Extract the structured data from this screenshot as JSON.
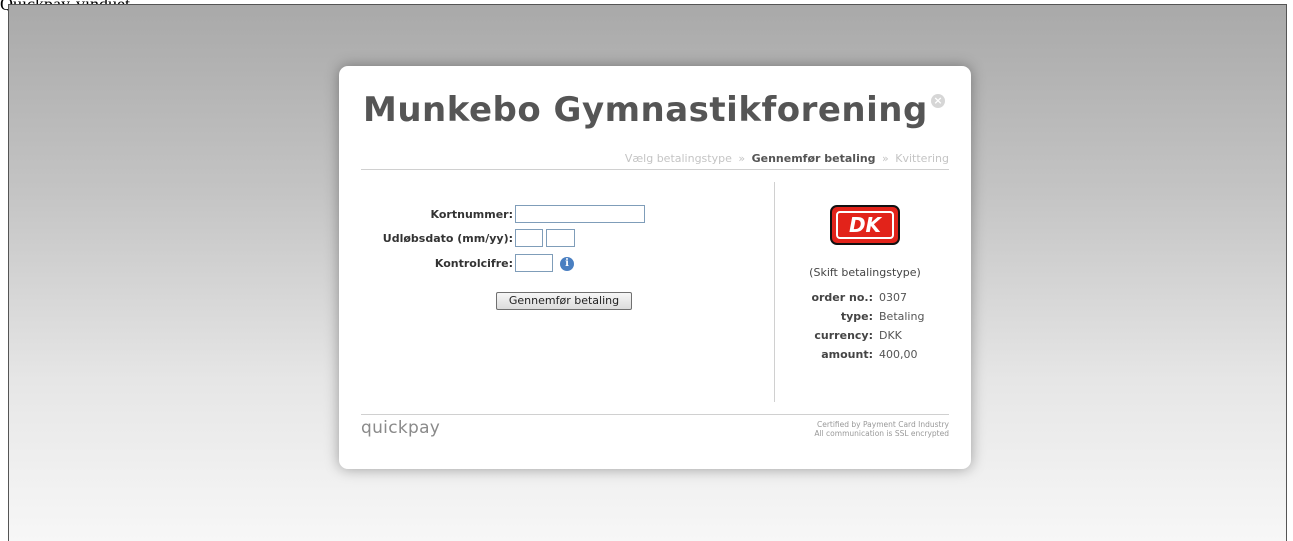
{
  "doc_text": "Quickpay-vinduet",
  "merchant": {
    "title": "Munkebo Gymnastikforening"
  },
  "steps": [
    "Vælg betalingstype",
    "Gennemfør betaling",
    "Kvittering"
  ],
  "step_separator": "»",
  "form": {
    "card_number_label": "Kortnummer:",
    "expiry_label": "Udløbsdato (mm/yy):",
    "cvc_label": "Kontrolcifre:",
    "card_number_value": "",
    "expiry_month_value": "",
    "expiry_year_value": "",
    "cvc_value": "",
    "submit_label": "Gennemfør betaling"
  },
  "payment": {
    "logo_text": "DK",
    "switch_label": "(Skift betalingstype)",
    "details": [
      {
        "key": "order no.:",
        "value": "0307"
      },
      {
        "key": "type:",
        "value": "Betaling"
      },
      {
        "key": "currency:",
        "value": "DKK"
      },
      {
        "key": "amount:",
        "value": "400,00"
      }
    ]
  },
  "footer": {
    "brand": "quickpay",
    "cert_line1": "Certified by Payment Card Industry",
    "cert_line2": "All communication is SSL encrypted"
  },
  "icons": {
    "close": "close-icon",
    "info": "info-icon"
  },
  "colors": {
    "title": "#555555",
    "dk_red": "#e2231a",
    "info_blue": "#4a7fc1"
  }
}
